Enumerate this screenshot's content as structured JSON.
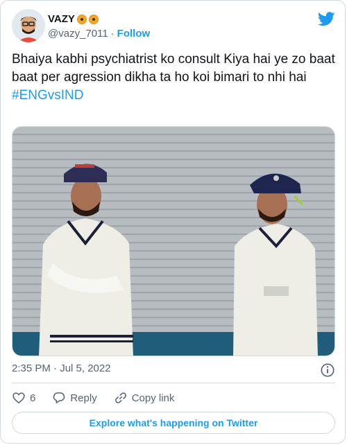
{
  "user": {
    "display_name": "VAZY",
    "handle": "@vazy_7011",
    "separator": "·",
    "follow_label": "Follow",
    "badges": [
      "radioactive-emoji",
      "biohazard-emoji"
    ]
  },
  "tweet": {
    "text": "Bhaiya kabhi psychiatrist ko consult Kiya hai ye zo baat baat per agression dikha ta ho koi bimari to nhi hai",
    "hashtag": "#ENGvsIND"
  },
  "meta": {
    "timestamp": "2:35 PM · Jul 5, 2022"
  },
  "actions": {
    "like_count": "6",
    "reply_label": "Reply",
    "copy_link_label": "Copy link"
  },
  "footer": {
    "explore_label": "Explore what's happening on Twitter"
  },
  "colors": {
    "accent": "#1d9bf0",
    "secondary_text": "#536471",
    "border": "#cfd9de"
  },
  "icons": {
    "brand": "twitter-bird-icon",
    "info": "info-icon",
    "like": "heart-icon",
    "reply": "reply-bubble-icon",
    "copy": "link-icon"
  }
}
